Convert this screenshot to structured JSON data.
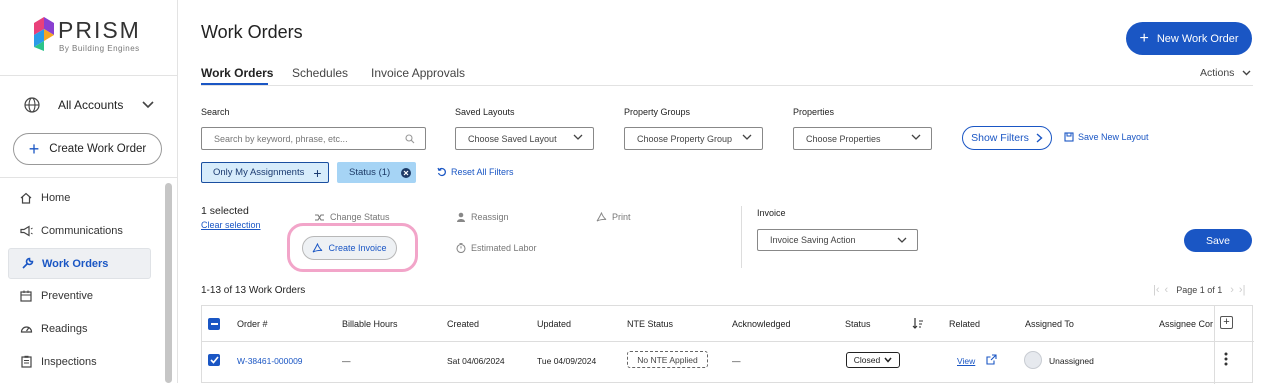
{
  "brand": {
    "name": "PRISM",
    "subtitle": "By Building Engines"
  },
  "sidebar": {
    "account_label": "All Accounts",
    "create_button": "Create Work Order",
    "items": [
      {
        "label": "Home",
        "icon": "home-icon"
      },
      {
        "label": "Communications",
        "icon": "megaphone-icon"
      },
      {
        "label": "Work Orders",
        "icon": "wrench-icon",
        "active": true
      },
      {
        "label": "Preventive",
        "icon": "calendar-icon"
      },
      {
        "label": "Readings",
        "icon": "gauge-icon"
      },
      {
        "label": "Inspections",
        "icon": "clipboard-icon"
      }
    ]
  },
  "header": {
    "title": "Work Orders",
    "new_button": "New Work Order"
  },
  "tabs": [
    "Work Orders",
    "Schedules",
    "Invoice Approvals"
  ],
  "actions_label": "Actions",
  "filters": {
    "search_label": "Search",
    "search_placeholder": "Search by keyword, phrase, etc...",
    "saved_layouts_label": "Saved Layouts",
    "saved_layouts_value": "Choose Saved Layout",
    "property_groups_label": "Property Groups",
    "property_groups_value": "Choose Property Group",
    "properties_label": "Properties",
    "properties_value": "Choose Properties",
    "show_filters": "Show Filters",
    "save_layout": "Save New Layout",
    "chip_assignments": "Only My Assignments",
    "chip_status": "Status (1)",
    "reset": "Reset All Filters"
  },
  "selection": {
    "selected_text": "1 selected",
    "clear_text": "Clear selection",
    "change_status": "Change Status",
    "create_invoice": "Create Invoice",
    "reassign": "Reassign",
    "estimated_labor": "Estimated Labor",
    "print": "Print",
    "invoice_label": "Invoice",
    "invoice_action": "Invoice Saving Action",
    "save": "Save"
  },
  "results": {
    "count_text": "1-13 of 13 Work Orders",
    "page_text": "Page 1 of 1"
  },
  "table": {
    "columns": [
      "Order #",
      "Billable Hours",
      "Created",
      "Updated",
      "NTE Status",
      "Acknowledged",
      "Status",
      "Related",
      "Assigned To",
      "Assignee Cor"
    ],
    "rows": [
      {
        "order": "W-38461-000009",
        "billable": "—",
        "created": "Sat 04/06/2024",
        "updated": "Tue 04/09/2024",
        "nte": "No NTE Applied",
        "ack": "—",
        "status": "Closed",
        "related": "View",
        "assigned": "Unassigned"
      }
    ]
  },
  "colors": {
    "accent": "#1a56c4",
    "highlight": "#f2a5c9"
  }
}
